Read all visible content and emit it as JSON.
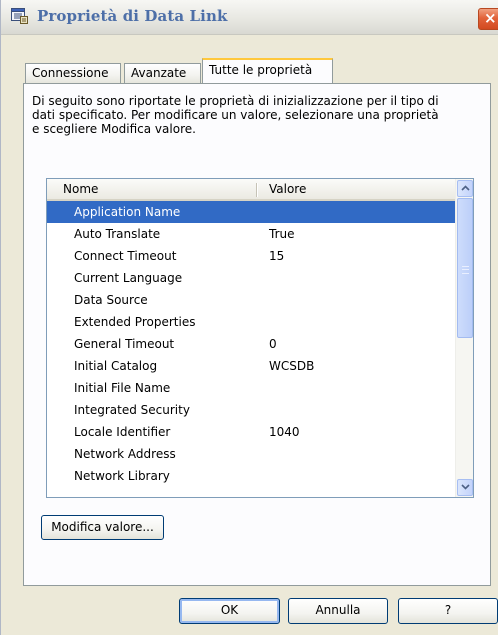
{
  "window": {
    "title": "Proprietà di Data Link",
    "close_label": "×"
  },
  "tabs": [
    {
      "label": "Connessione",
      "active": false
    },
    {
      "label": "Avanzate",
      "active": false
    },
    {
      "label": "Tutte le proprietà",
      "active": true
    }
  ],
  "description": "Di seguito sono riportate le proprietà di inizializzazione per il tipo di\ndati specificato. Per modificare un valore, selezionare una proprietà\ne scegliere Modifica valore.",
  "properties_list": {
    "columns": [
      "Nome",
      "Valore"
    ],
    "rows": [
      {
        "name": "Application Name",
        "value": "",
        "selected": true
      },
      {
        "name": "Auto Translate",
        "value": "True"
      },
      {
        "name": "Connect Timeout",
        "value": "15"
      },
      {
        "name": "Current Language",
        "value": ""
      },
      {
        "name": "Data Source",
        "value": ""
      },
      {
        "name": "Extended Properties",
        "value": ""
      },
      {
        "name": "General Timeout",
        "value": "0"
      },
      {
        "name": "Initial Catalog",
        "value": "WCSDB"
      },
      {
        "name": "Initial File Name",
        "value": ""
      },
      {
        "name": "Integrated Security",
        "value": ""
      },
      {
        "name": "Locale Identifier",
        "value": "1040"
      },
      {
        "name": "Network Address",
        "value": ""
      },
      {
        "name": "Network Library",
        "value": ""
      }
    ]
  },
  "buttons": {
    "edit_value": "Modifica valore...",
    "ok": "OK",
    "cancel": "Annulla",
    "help": "?"
  },
  "colors": {
    "selection": "#316ac5",
    "title_text": "#4d6fa8",
    "active_tab_accent": "#ffc83c"
  },
  "icons": {
    "title": "properties-window-icon",
    "close": "close-x-icon",
    "scroll_up": "chevron-up-icon",
    "scroll_down": "chevron-down-icon"
  }
}
